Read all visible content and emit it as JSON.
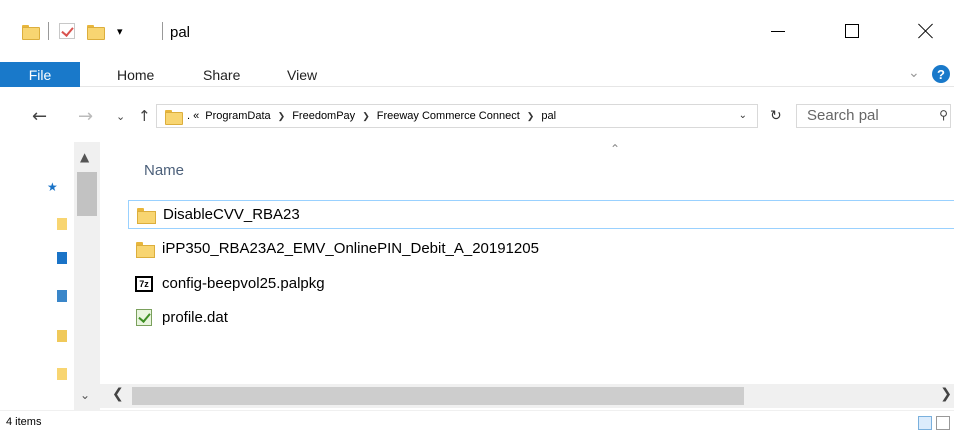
{
  "window": {
    "title": "pal",
    "qat_down": "▾"
  },
  "ribbon": {
    "tabs": [
      {
        "label": "File"
      },
      {
        "label": "Home"
      },
      {
        "label": "Share"
      },
      {
        "label": "View"
      }
    ],
    "help": "?"
  },
  "address": {
    "prefix": ". «",
    "crumbs": [
      "ProgramData",
      "FreedomPay",
      "Freeway Commerce Connect",
      "pal"
    ]
  },
  "search": {
    "placeholder": "Search pal"
  },
  "columns": {
    "name": "Name"
  },
  "files": [
    {
      "name": "DisableCVV_RBA23",
      "icon": "folder-icon"
    },
    {
      "name": "iPP350_RBA23A2_EMV_OnlinePIN_Debit_A_20191205",
      "icon": "folder-icon"
    },
    {
      "name": "config-beepvol25.palpkg",
      "icon": "7z-archive-icon",
      "icon_text": "7z"
    },
    {
      "name": "profile.dat",
      "icon": "dat-file-icon"
    }
  ],
  "status": {
    "item_count": "4 items"
  }
}
